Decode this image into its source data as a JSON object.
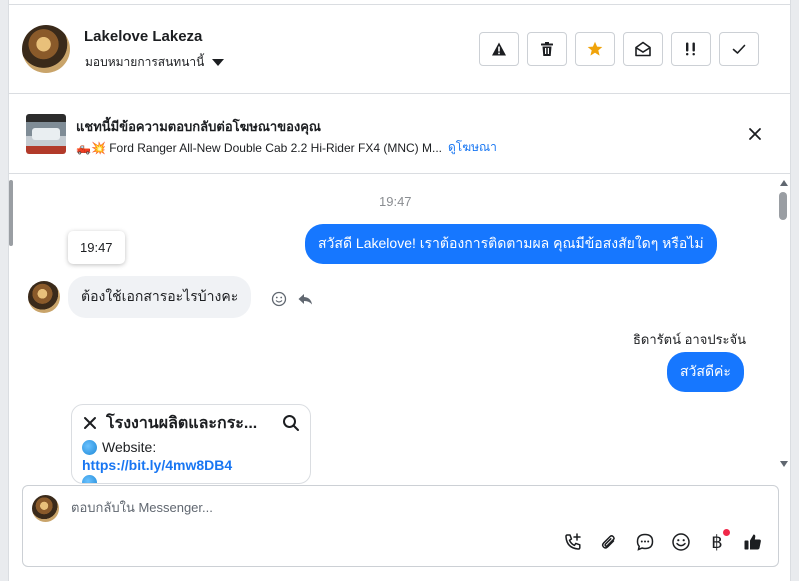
{
  "header": {
    "contact_name": "Lakelove Lakeza",
    "assign_label": "มอบหมายการสนทนานี้",
    "buttons": [
      "warning-icon",
      "trash-icon",
      "star-icon",
      "envelope-open-icon",
      "priority-icon",
      "check-icon"
    ],
    "accent_star": "#f0a30a"
  },
  "ad_banner": {
    "title": "แชทนี้มีข้อความตอบกลับต่อโฆษณาของคุณ",
    "subtitle": "🛻💥 Ford Ranger All-New Double Cab 2.2 Hi-Rider FX4 (MNC) M...",
    "link_label": "ดูโฆษณา"
  },
  "conversation": {
    "timestamp": "19:47",
    "tooltip_time": "19:47",
    "messages": [
      {
        "direction": "outgoing",
        "text": "สวัสดี Lakelove! เราต้องการติดตามผล คุณมีข้อสงสัยใดๆ หรือไม่"
      },
      {
        "direction": "incoming",
        "text": "ต้องใช้เอกสารอะไรบ้างคะ"
      },
      {
        "direction": "outgoing",
        "sender": "ธิดารัตน์ อาจประจัน",
        "text": "สวัสดีค่ะ"
      }
    ],
    "card": {
      "title": "โรงงานผลิตและกระ...",
      "line_label": "Website:",
      "url": "https://bit.ly/4mw8DB4"
    }
  },
  "composer": {
    "placeholder": "ตอบกลับใน Messenger...",
    "tools": [
      "call-add-icon",
      "attach-icon",
      "saved-reply-icon",
      "emoji-icon",
      "payment-icon",
      "thumbs-up-icon"
    ],
    "payment_symbol": "฿"
  },
  "colors": {
    "bubble_outgoing": "#1677ff",
    "bubble_incoming": "#f0f2f5",
    "link": "#1876f2"
  }
}
